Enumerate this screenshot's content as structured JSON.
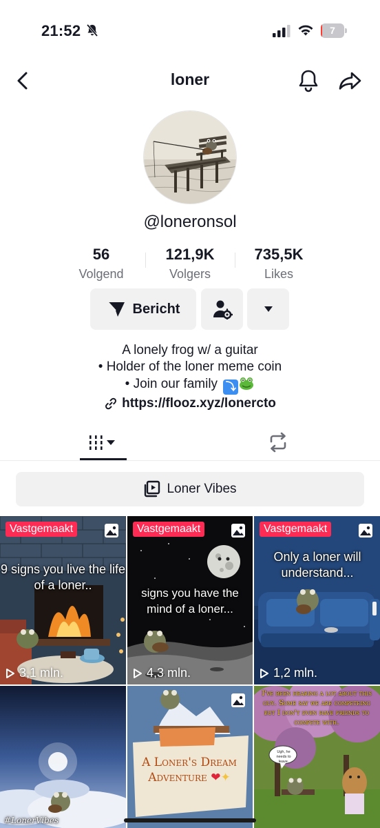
{
  "status": {
    "time": "21:52",
    "battery": "7",
    "battery_level": 0.07,
    "icons": [
      "bell-slash-icon",
      "signal-icon",
      "wifi-icon",
      "battery-icon"
    ]
  },
  "header": {
    "title": "loner",
    "icons": [
      "chevron-left-icon",
      "bell-icon",
      "share-icon"
    ]
  },
  "profile": {
    "username": "@loneronsol",
    "stats": [
      {
        "value": "56",
        "label": "Volgend"
      },
      {
        "value": "121,9K",
        "label": "Volgers"
      },
      {
        "value": "735,5K",
        "label": "Likes"
      }
    ],
    "message_button": "Bericht",
    "bio": {
      "line1": "A lonely frog w/ a guitar",
      "line2": "• Holder of the loner meme coin",
      "line3": "• Join our family"
    },
    "link": "https://flooz.xyz/lonercto"
  },
  "tabs": {
    "icons": [
      "grid-icon",
      "repost-icon"
    ]
  },
  "playlist": {
    "label": "Loner Vibes"
  },
  "videos": [
    {
      "pinned": "Vastgemaakt",
      "caption": "9 signs you live the life of a loner..",
      "views": "3,1 mln."
    },
    {
      "pinned": "Vastgemaakt",
      "caption": "signs you have the mind of a loner...",
      "views": "4,3 mln."
    },
    {
      "pinned": "Vastgemaakt",
      "caption": "Only a loner will understand...",
      "views": "1,2 mln."
    },
    {
      "caption": "#LonerVibes"
    },
    {
      "caption_line1": "A Loner's Dream",
      "caption_line2": "Adventure"
    },
    {
      "caption": "I've been hearing a lot about this guy. Some say we are competeing but I don't even have friends to compete with.",
      "bubble": "Ugh, he needs to leave."
    }
  ],
  "colors": {
    "pinned_badge": "#fe2c55",
    "button_bg": "#f1f1f2",
    "text": "#161823",
    "muted": "#6b6e76"
  }
}
